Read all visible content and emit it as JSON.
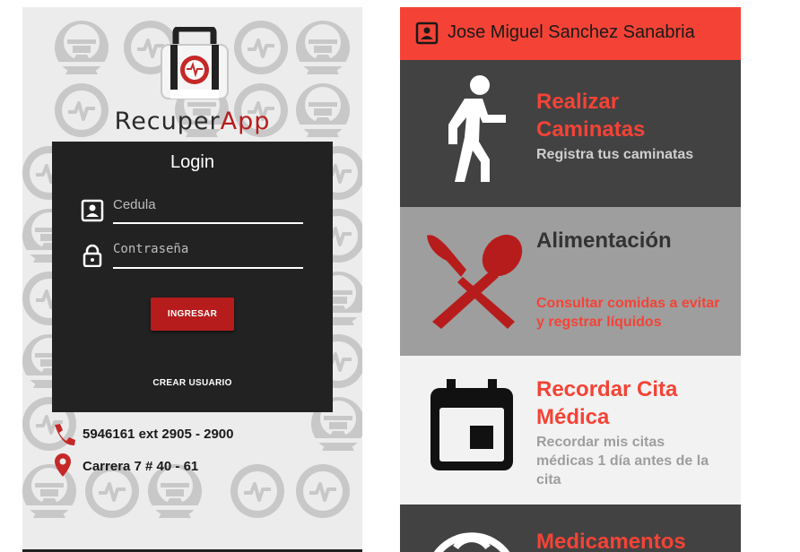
{
  "login_screen": {
    "app_name_part1": "Recuper",
    "app_name_part2": "App",
    "card_title": "Login",
    "id_placeholder": "Cedula",
    "password_placeholder": "Contraseña",
    "login_button": "INGRESAR",
    "create_user_button": "CREAR USUARIO",
    "phone_text": "5946161 ext 2905 - 2900",
    "address_text": "Carrera 7 # 40 - 61"
  },
  "menu_screen": {
    "user_name": "Jose Miguel Sanchez Sanabria",
    "tiles": [
      {
        "title_line1": "Realizar",
        "title_line2": "Caminatas",
        "sub_line1": "Registra tus caminatas",
        "icon": "walking-person-icon"
      },
      {
        "title_line1": "Alimentación",
        "sub_line1": "Consultar comidas a evitar",
        "sub_line2": "y regstrar líquidos",
        "icon": "knife-spoon-icon"
      },
      {
        "title_line1": "Recordar Cita",
        "title_line2": "Médica",
        "sub_line1": "Recordar mis citas",
        "sub_line2": "médicas 1 día antes de la",
        "sub_line3": "cita",
        "icon": "calendar-icon"
      },
      {
        "title_line1": "Medicamentos",
        "icon": "clock-icon"
      }
    ]
  },
  "colors": {
    "accent_red": "#b71c1c",
    "bright_red": "#f44336",
    "dark_tile": "#424242",
    "gray_tile": "#9e9e9e",
    "light_tile": "#f2f2f2",
    "login_card": "#222222"
  }
}
